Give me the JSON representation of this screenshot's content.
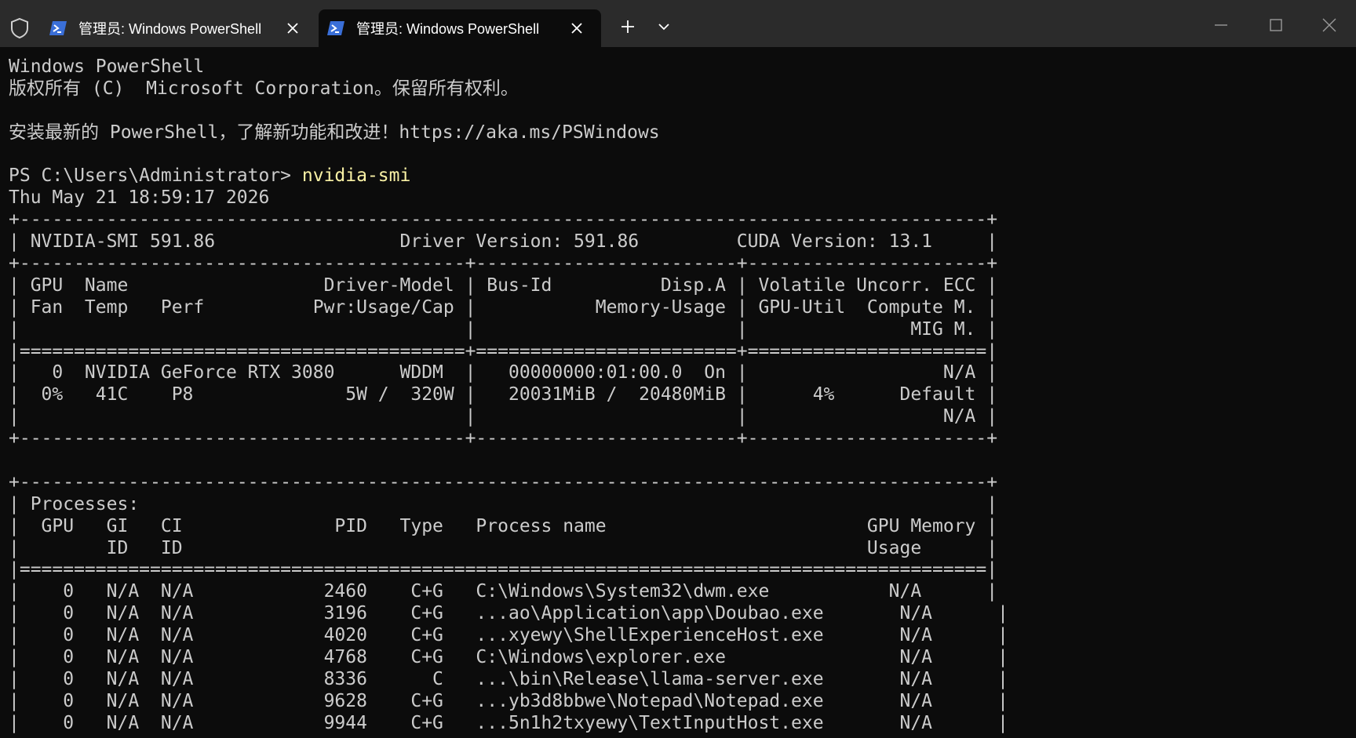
{
  "window": {
    "tabs": [
      {
        "title": "管理员: Windows PowerShell",
        "active": false
      },
      {
        "title": "管理员: Windows PowerShell",
        "active": true
      }
    ]
  },
  "icons": {
    "shield": "shield-icon",
    "powershell": "powershell-icon",
    "close": "close-icon",
    "new_tab": "plus-icon",
    "dropdown": "chevron-down-icon",
    "minimize": "minimize-icon",
    "maximize": "maximize-icon",
    "window_close": "window-close-icon"
  },
  "colors": {
    "titlebar_bg": "#2b2b2b",
    "terminal_bg": "#0c0c0c",
    "terminal_fg": "#cccccc",
    "command_fg": "#f9f1a5",
    "powershell_icon": "#3a6fd8"
  },
  "terminal": {
    "header": [
      "Windows PowerShell",
      "版权所有 (C)  Microsoft Corporation。保留所有权利。",
      "",
      "安装最新的 PowerShell，了解新功能和改进！https://aka.ms/PSWindows",
      ""
    ],
    "prompt": "PS C:\\Users\\Administrator> ",
    "command": "nvidia-smi",
    "output": [
      "Thu May 21 18:59:17 2026",
      "+-----------------------------------------------------------------------------------------+",
      "| NVIDIA-SMI 591.86                 Driver Version: 591.86         CUDA Version: 13.1     |",
      "+-----------------------------------------+------------------------+----------------------+",
      "| GPU  Name                  Driver-Model | Bus-Id          Disp.A | Volatile Uncorr. ECC |",
      "| Fan  Temp   Perf          Pwr:Usage/Cap |           Memory-Usage | GPU-Util  Compute M. |",
      "|                                         |                        |               MIG M. |",
      "|=========================================+========================+======================|",
      "|   0  NVIDIA GeForce RTX 3080      WDDM  |   00000000:01:00.0  On |                  N/A |",
      "|  0%   41C    P8              5W /  320W |   20031MiB /  20480MiB |      4%      Default |",
      "|                                         |                        |                  N/A |",
      "+-----------------------------------------+------------------------+----------------------+",
      "",
      "+-----------------------------------------------------------------------------------------+",
      "| Processes:                                                                              |",
      "|  GPU   GI   CI              PID   Type   Process name                        GPU Memory |",
      "|        ID   ID                                                               Usage      |",
      "|=========================================================================================|",
      "|    0   N/A  N/A            2460    C+G   C:\\Windows\\System32\\dwm.exe           N/A      |",
      "|    0   N/A  N/A            3196    C+G   ...ao\\Application\\app\\Doubao.exe       N/A      |",
      "|    0   N/A  N/A            4020    C+G   ...xyewy\\ShellExperienceHost.exe       N/A      |",
      "|    0   N/A  N/A            4768    C+G   C:\\Windows\\explorer.exe                N/A      |",
      "|    0   N/A  N/A            8336      C   ...\\bin\\Release\\llama-server.exe       N/A      |",
      "|    0   N/A  N/A            9628    C+G   ...yb3d8bbwe\\Notepad\\Notepad.exe       N/A      |",
      "|    0   N/A  N/A            9944    C+G   ...5n1h2txyewy\\TextInputHost.exe       N/A      |"
    ]
  }
}
